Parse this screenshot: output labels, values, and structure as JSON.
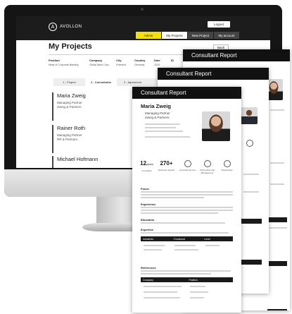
{
  "app": {
    "logo": "AVOLLON",
    "logout": "Logout",
    "tabs": [
      "Admin",
      "My Projects",
      "New Project",
      "My account"
    ]
  },
  "page": {
    "title": "My Projects",
    "back": "Back",
    "project_headers": [
      "Position",
      "Company",
      "City",
      "Country",
      "Date",
      "ID"
    ],
    "project_values": [
      "Head of Corporate Banking",
      "Global Bank Corp.",
      "Frankfurt",
      "Germany",
      "2018",
      ""
    ],
    "steps": [
      "1 - Project",
      "2 - Consultants",
      "3 - Agreement",
      "4 - Invoice"
    ],
    "consultants": [
      {
        "name": "Maria Zweig",
        "role1": "Managing Partner",
        "role2": "Zweig & Partners"
      },
      {
        "name": "Rainer Roth",
        "role1": "Managing Partner",
        "role2": "RR & Partners"
      },
      {
        "name": "Michael Hofmann",
        "role1": "",
        "role2": ""
      }
    ]
  },
  "report": {
    "title": "Consultant Report",
    "name": "Maria Zweig",
    "role1": "Managing Partner",
    "role2": "Zweig & Partners",
    "stats": [
      {
        "value": "12",
        "unit": "years",
        "label": "Consultant"
      },
      {
        "value": "270+",
        "unit": "",
        "label": "Executive Search"
      },
      {
        "value": "",
        "unit": "",
        "label": "Financial Service"
      },
      {
        "value": "",
        "unit": "",
        "label": "Partnership and Management"
      },
      {
        "value": "",
        "unit": "",
        "label": "Shareholder"
      }
    ],
    "sections": [
      "Focus",
      "Experience",
      "Education",
      "Expertise",
      "References"
    ],
    "expertise_headers": [
      "Industries",
      "Functional",
      "Level"
    ],
    "reference_headers": [
      "Company",
      "Position"
    ]
  }
}
